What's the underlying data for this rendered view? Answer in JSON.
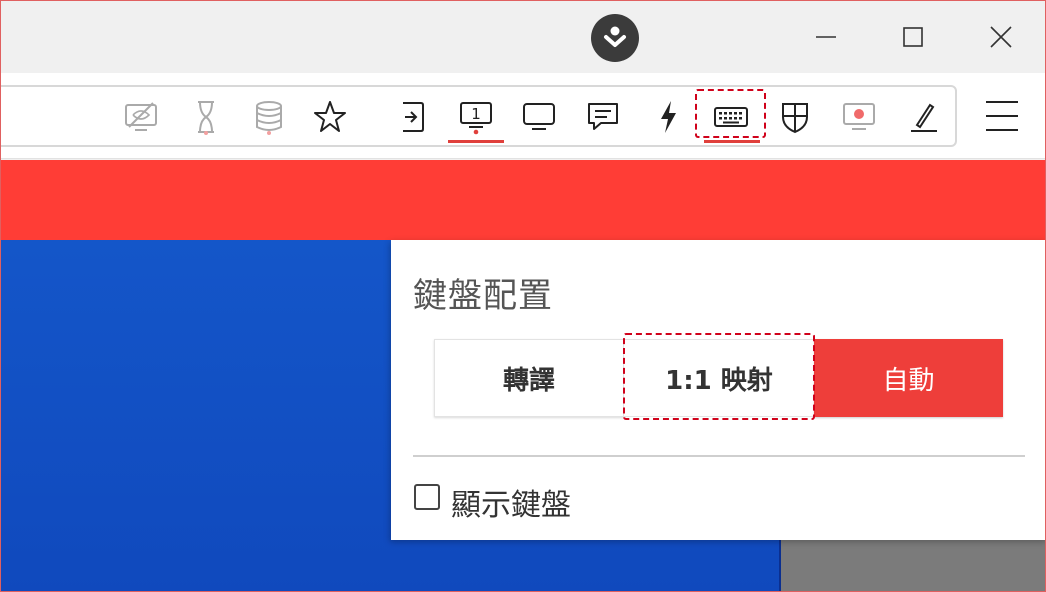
{
  "window": {
    "controls": [
      "minimize-icon",
      "maximize-icon",
      "close-icon"
    ],
    "center_icon": "download-circle-icon"
  },
  "toolbar": {
    "icons": [
      {
        "name": "screen-off-icon",
        "state": "disabled"
      },
      {
        "name": "hourglass-icon",
        "state": "disabled"
      },
      {
        "name": "database-icon",
        "state": "disabled"
      },
      {
        "name": "star-icon",
        "state": "normal"
      },
      {
        "name": "enter-icon",
        "state": "normal"
      },
      {
        "name": "screen-one-icon",
        "label": "1",
        "state": "active"
      },
      {
        "name": "monitor-icon",
        "state": "normal"
      },
      {
        "name": "chat-icon",
        "state": "normal"
      },
      {
        "name": "lightning-icon",
        "state": "normal"
      },
      {
        "name": "keyboard-icon",
        "state": "active"
      },
      {
        "name": "shield-icon",
        "state": "normal"
      },
      {
        "name": "record-icon",
        "state": "normal"
      },
      {
        "name": "pen-icon",
        "state": "normal"
      }
    ],
    "menu_icon": "hamburger-icon"
  },
  "colors": {
    "accent": "#ff3d36",
    "button_active": "#ee3e3a",
    "highlight_dash": "#d0021b",
    "desktop_blue": "#1456c9"
  },
  "panel": {
    "title": "鍵盤配置",
    "modes": [
      {
        "label": "轉譯",
        "selected": false
      },
      {
        "label": "1:1 映射",
        "selected": false
      },
      {
        "label": "自動",
        "selected": true
      }
    ],
    "show_keyboard": {
      "label": "顯示鍵盤",
      "checked": false
    }
  }
}
